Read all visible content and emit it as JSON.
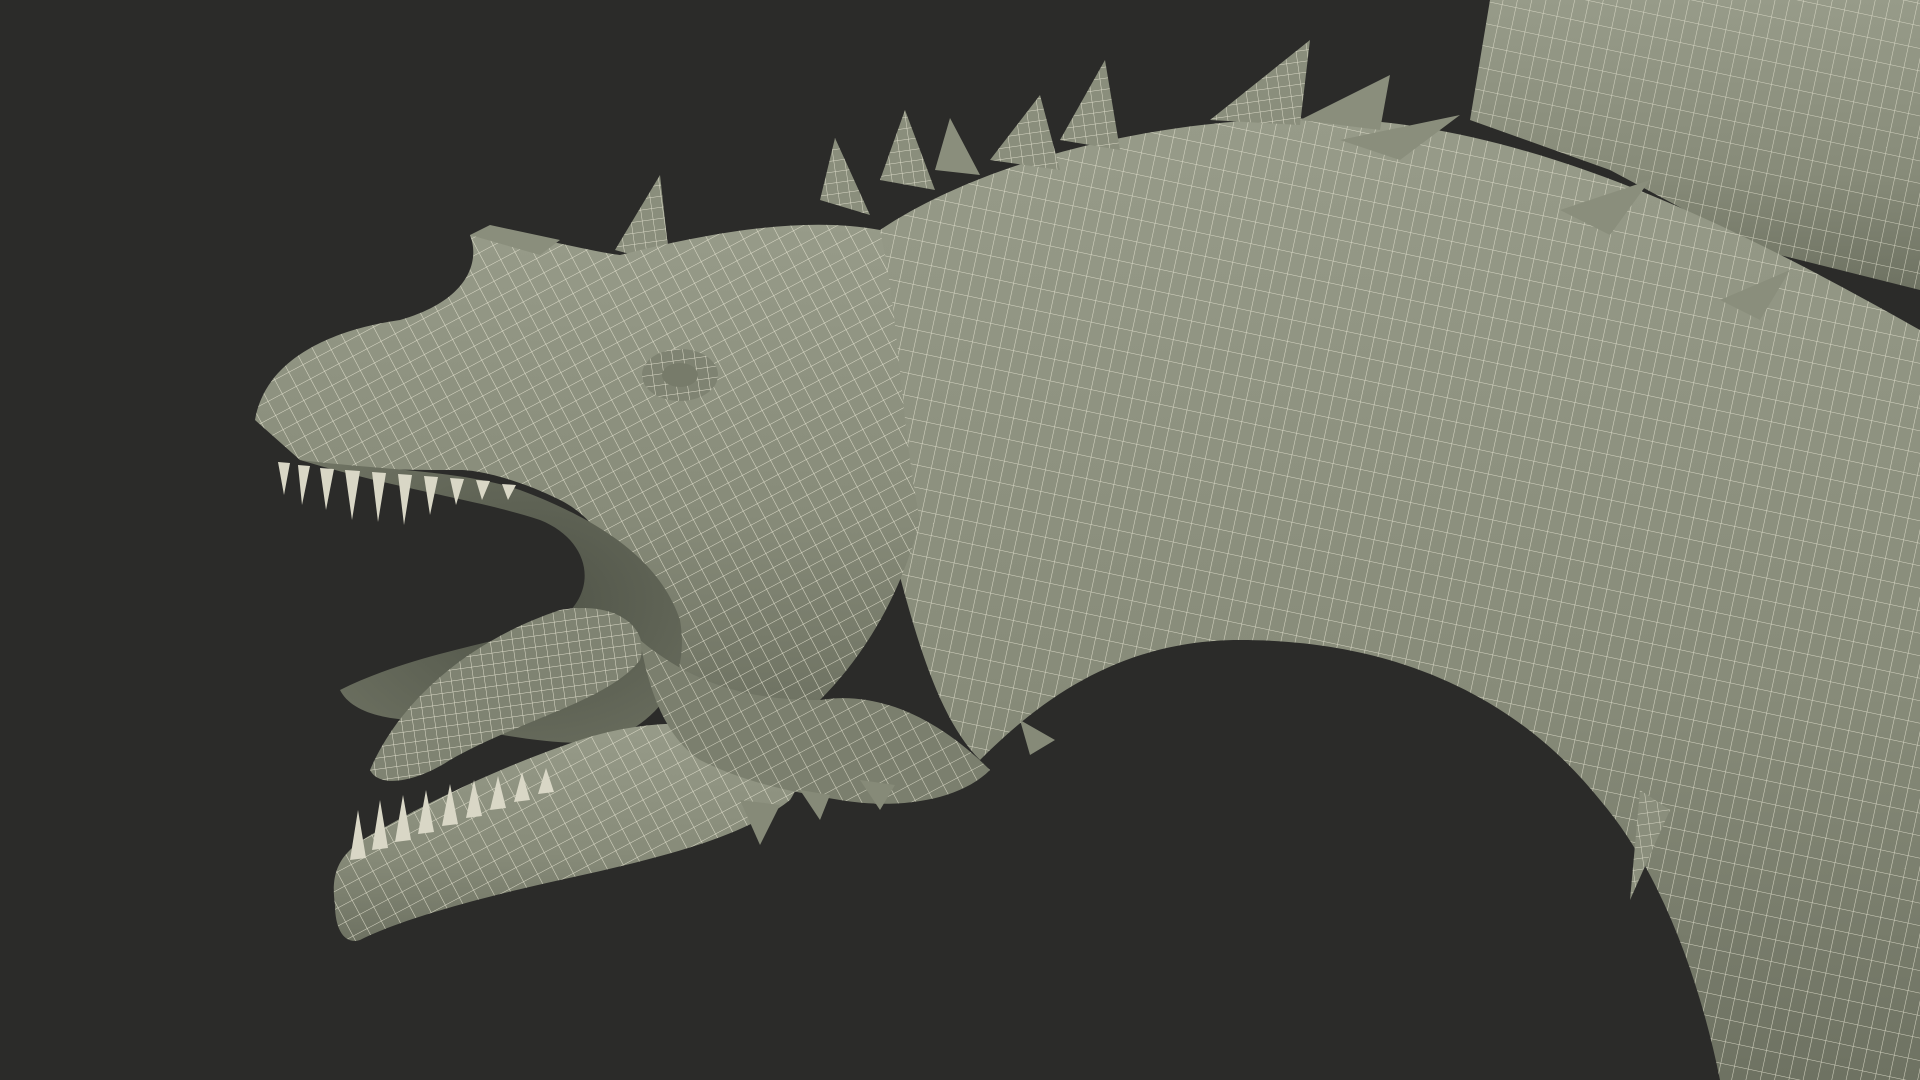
{
  "scene": {
    "subject": "dragon-head-wireframe",
    "colors": {
      "background": "#2b2b29",
      "surface": "#878b79",
      "surface_shadow": "#6e7262",
      "surface_highlight": "#979b89",
      "wire": "#e9e7d5",
      "mouth_interior": "#5e6254",
      "teeth": "#d9d7c6"
    }
  }
}
